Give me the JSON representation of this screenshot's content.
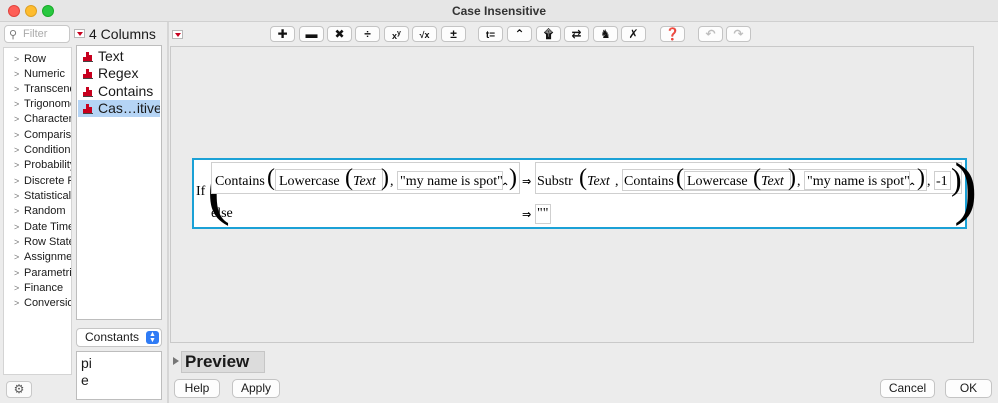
{
  "window": {
    "title": "Case Insensitive"
  },
  "filter": {
    "placeholder": "Filter"
  },
  "categories": [
    "Row",
    "Numeric",
    "Transcendental",
    "Trigonometric",
    "Character",
    "Comparison",
    "Conditional",
    "Probability",
    "Discrete Probability",
    "Statistical",
    "Random",
    "Date Time",
    "Row State",
    "Assignment",
    "Parametric Model",
    "Finance",
    "Conversion"
  ],
  "columns": {
    "count_label": "4 Columns",
    "items": [
      "Text",
      "Regex",
      "Contains",
      "Cas…itive"
    ],
    "selected_index": 3
  },
  "constants": {
    "selected": "Constants",
    "items": [
      "pi",
      "e"
    ]
  },
  "toolbar": {
    "buttons": [
      "add",
      "subtract",
      "multiply",
      "divide",
      "power",
      "root",
      "plus-minus",
      "assign",
      "insert-term",
      "peel",
      "swap",
      "local",
      "delete",
      "help",
      "undo",
      "redo"
    ]
  },
  "formula": {
    "if": "If",
    "contains": "Contains",
    "lowercase": "Lowercase",
    "text_col": "Text",
    "comma": ",",
    "string_arg": "\"my name is spot\"",
    "then_arrow": "⇒",
    "substr": "Substr",
    "minus_one": "-1",
    "else": "else",
    "empty_string": "\"\""
  },
  "preview": {
    "label": "Preview"
  },
  "buttons": {
    "help": "Help",
    "apply": "Apply",
    "cancel": "Cancel",
    "ok": "OK"
  }
}
